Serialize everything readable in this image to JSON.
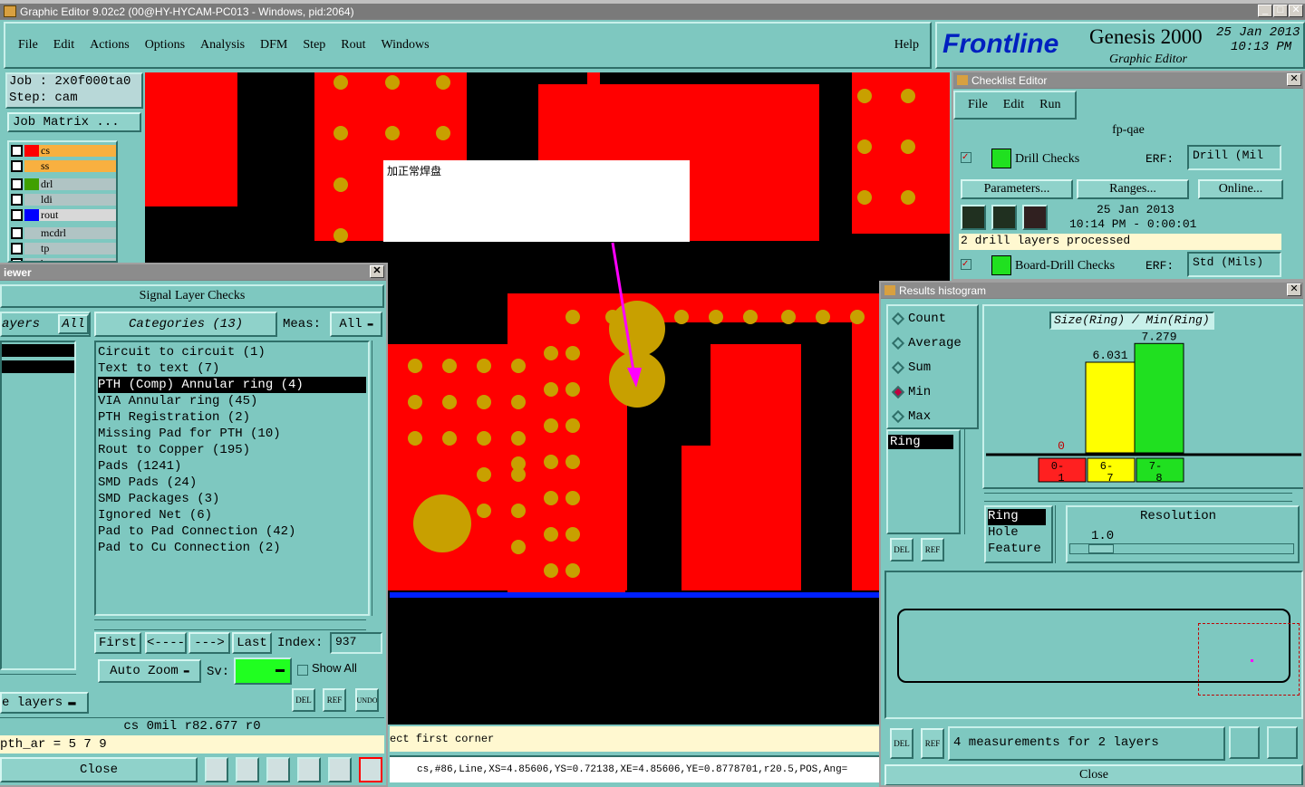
{
  "window_title": "Graphic Editor 9.02c2 (00@HY-HYCAM-PC013 - Windows, pid:2064)",
  "menu": [
    "File",
    "Edit",
    "Actions",
    "Options",
    "Analysis",
    "DFM",
    "Step",
    "Rout",
    "Windows"
  ],
  "help": "Help",
  "brand": {
    "logo": "Frontline",
    "product": "Genesis 2000",
    "subtitle": "Graphic Editor",
    "date": "25 Jan 2013",
    "time": "10:13 PM"
  },
  "job": {
    "job_line": "Job : 2x0f000ta0",
    "step_line": "Step: cam",
    "matrix_button": "Job Matrix ..."
  },
  "layers": [
    {
      "name": "cs",
      "color": "#ff0000",
      "bg": "#f8b040"
    },
    {
      "name": "ss",
      "color": "#f8b040",
      "bg": "#f8b040"
    },
    {
      "name": "drl",
      "color": "#40a000",
      "bg": "#b0c4c4"
    },
    {
      "name": "ldi",
      "color": "#b0c4c4",
      "bg": "#b0c4c4"
    },
    {
      "name": "rout",
      "color": "#0000ff",
      "bg": "#d8d8d8"
    },
    {
      "name": "mcdrl",
      "color": "#b0c4c4",
      "bg": "#b0c4c4"
    },
    {
      "name": "tp",
      "color": "#b0c4c4",
      "bg": "#b0c4c4"
    },
    {
      "name": "bp",
      "color": "#b0c4c4",
      "bg": "#b0c4c4"
    }
  ],
  "canvas_note": "加正常焊盘",
  "viewer": {
    "title": "iewer",
    "panel_title": "Signal Layer Checks",
    "layers_label": "ayers",
    "all_label": "All",
    "categories_label": "Categories (13)",
    "meas_label": "Meas:",
    "meas_value": "All",
    "categories": [
      "Circuit to circuit (1)",
      "Text to text (7)",
      "PTH (Comp) Annular ring (4)",
      "VIA Annular ring (45)",
      "PTH Registration (2)",
      "Missing Pad for PTH (10)",
      "Rout to Copper (195)",
      "Pads (1241)",
      "SMD Pads (24)",
      "SMD Packages (3)",
      "Ignored Net (6)",
      "Pad to Pad Connection (42)",
      "Pad to Cu Connection (2)"
    ],
    "selected_index": 2,
    "nav": {
      "first": "First",
      "prev": "<----",
      "next": "--->",
      "last": "Last",
      "index_label": "Index:",
      "index_value": "937"
    },
    "auto_zoom": "Auto Zoom",
    "sv_label": "Sv:",
    "show_all": "Show All",
    "side_layers": "e layers",
    "status1": "cs 0mil   r82.677  r0",
    "status2": "pth_ar = 5 7 9",
    "close": "Close",
    "icon_labels": [
      "DEL",
      "REF",
      "UNDO"
    ]
  },
  "prompt": "ect first corner",
  "coord_status": "cs,#86,Line,XS=4.85606,YS=0.72138,XE=4.85606,YE=0.8778701,r20.5,POS,Ang=",
  "checklist": {
    "title": "Checklist Editor",
    "menu": [
      "File",
      "Edit",
      "Run"
    ],
    "name": "fp-qae",
    "check1": "Drill Checks",
    "erf_label": "ERF:",
    "erf1": "Drill (Mil",
    "parameters": "Parameters...",
    "ranges": "Ranges...",
    "online": "Online...",
    "run_date": "25 Jan 2013",
    "run_time": "10:14 PM - 0:00:01",
    "status": "2 drill layers processed",
    "check2": "Board-Drill Checks",
    "erf2": "Std (Mils)"
  },
  "histogram": {
    "title": "Results histogram",
    "modes": [
      "Count",
      "Average",
      "Sum",
      "Min",
      "Max"
    ],
    "selected_mode": "Min",
    "list_item": "Ring",
    "chart_title": "Size(Ring) / Min(Ring)",
    "bars": [
      {
        "label": "0",
        "value": 0,
        "range": "0-\n1",
        "color": "#ff2020"
      },
      {
        "label": "6.031",
        "value": 6.031,
        "range": "6-\n7",
        "color": "#ffff00"
      },
      {
        "label": "7.279",
        "value": 7.279,
        "range": "7-\n8",
        "color": "#20e020"
      }
    ],
    "measure_list": [
      "Ring",
      "Hole",
      "Feature"
    ],
    "resolution_label": "Resolution",
    "resolution_value": "1.0",
    "summary": "4 measurements for 2 layers",
    "close": "Close"
  }
}
